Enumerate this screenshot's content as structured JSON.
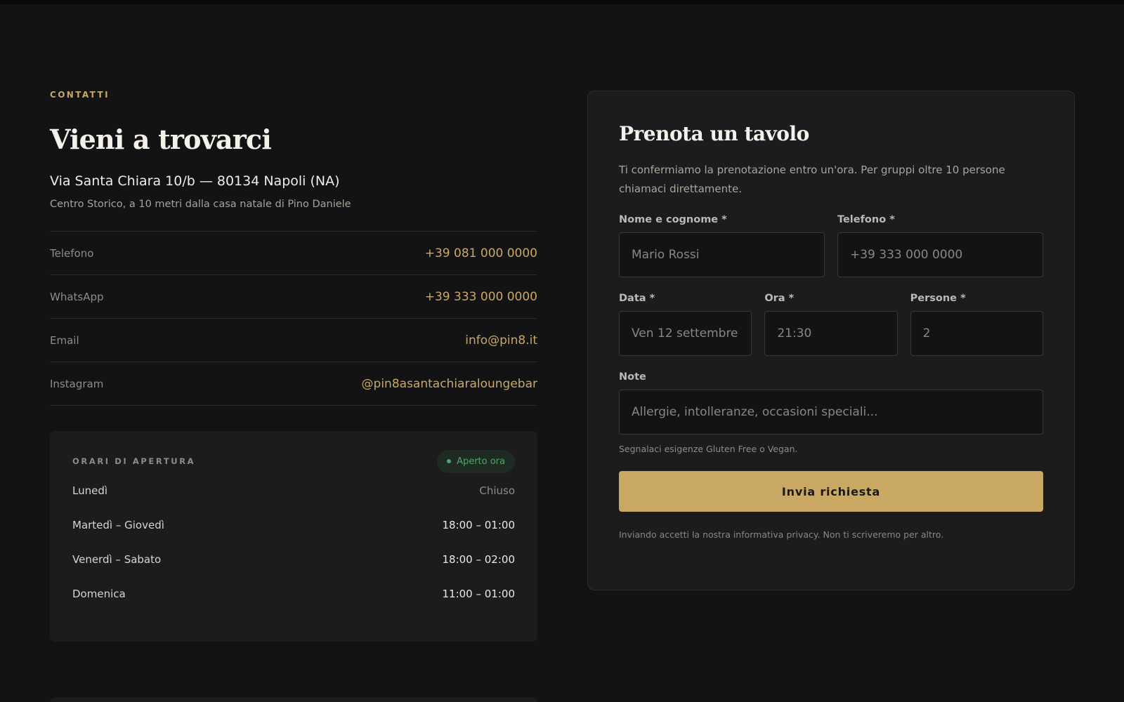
{
  "colors": {
    "background": "#131315",
    "card": "#1c1c1e",
    "accent": "#c9a864",
    "status_open": "#4fa66a"
  },
  "contact": {
    "eyebrow": "CONTATTI",
    "title": "Vieni a trovarci",
    "address": "Via Santa Chiara 10/b — 80134 Napoli (NA)",
    "sub_address": "Centro Storico, a 10 metri dalla casa natale di Pino Daniele",
    "rows": [
      {
        "label": "Telefono",
        "value": "+39 081 000 0000"
      },
      {
        "label": "WhatsApp",
        "value": "+39 333 000 0000"
      },
      {
        "label": "Email",
        "value": "info@pin8.it"
      },
      {
        "label": "Instagram",
        "value": "@pin8asantachiaraloungebar"
      }
    ]
  },
  "hours": {
    "title": "ORARI DI APERTURA",
    "status": "Aperto ora",
    "rows": [
      {
        "day": "Lunedì",
        "time": "Chiuso"
      },
      {
        "day": "Martedì – Giovedì",
        "time": "18:00 – 01:00"
      },
      {
        "day": "Venerdì – Sabato",
        "time": "18:00 – 02:00"
      },
      {
        "day": "Domenica",
        "time": "11:00 – 01:00"
      }
    ]
  },
  "booking": {
    "title": "Prenota un tavolo",
    "description": "Ti confermiamo la prenotazione entro un'ora. Per gruppi oltre 10 persone chiamaci direttamente.",
    "fields": {
      "name": {
        "label": "Nome e cognome *",
        "placeholder": "Mario Rossi"
      },
      "phone": {
        "label": "Telefono *",
        "placeholder": "+39 333 000 0000"
      },
      "date": {
        "label": "Data *",
        "placeholder": "Ven 12 settembre"
      },
      "time": {
        "label": "Ora *",
        "placeholder": "21:30"
      },
      "guests": {
        "label": "Persone *",
        "placeholder": "2"
      },
      "notes": {
        "label": "Note",
        "placeholder": "Allergie, intolleranze, occasioni speciali..."
      }
    },
    "notes_hint": "Segnalaci esigenze Gluten Free o Vegan.",
    "submit_label": "Invia richiesta",
    "privacy_note": "Inviando accetti la nostra informativa privacy. Non ti scriveremo per altro."
  }
}
